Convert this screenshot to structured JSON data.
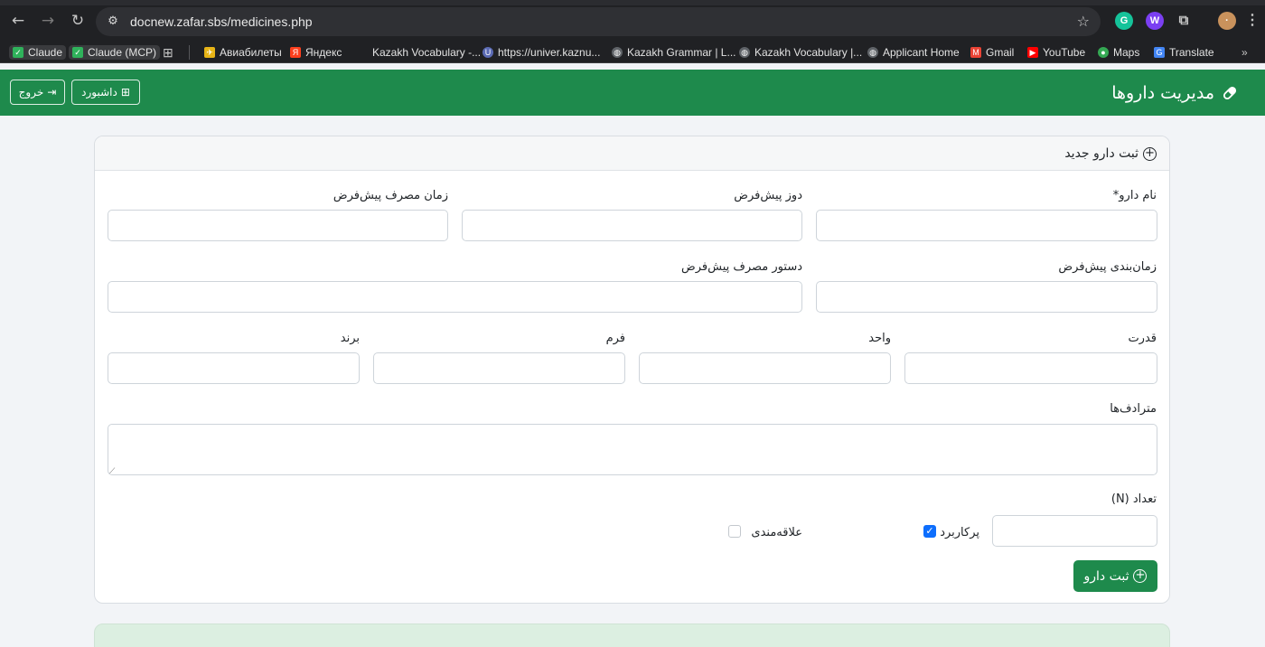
{
  "browser": {
    "url": "docnew.zafar.sbs/medicines.php",
    "bookmarks": [
      {
        "label": "Claude"
      },
      {
        "label": "Claude (MCP)"
      },
      {
        "label": "Авиабилеты"
      },
      {
        "label": "Яндекс"
      },
      {
        "label": "Kazakh Vocabulary -..."
      },
      {
        "label": "https://univer.kaznu..."
      },
      {
        "label": "Kazakh Grammar | L..."
      },
      {
        "label": "Kazakh Vocabulary |..."
      },
      {
        "label": "Applicant Home"
      },
      {
        "label": "Gmail"
      },
      {
        "label": "YouTube"
      },
      {
        "label": "Maps"
      },
      {
        "label": "Translate"
      }
    ],
    "overflow": "»"
  },
  "header": {
    "title": "مدیریت داروها",
    "dashboard_label": "داشبورد",
    "logout_label": "خروج"
  },
  "form": {
    "card_title": "ثبت دارو جدید",
    "fields": {
      "name": {
        "label": "نام دارو*",
        "value": ""
      },
      "default_dose": {
        "label": "دوز پیش‌فرض",
        "value": ""
      },
      "default_time": {
        "label": "زمان مصرف پیش‌فرض",
        "value": ""
      },
      "default_schedule": {
        "label": "زمان‌بندی پیش‌فرض",
        "value": ""
      },
      "default_instruction": {
        "label": "دستور مصرف پیش‌فرض",
        "value": ""
      },
      "strength": {
        "label": "قدرت",
        "value": ""
      },
      "unit": {
        "label": "واحد",
        "value": ""
      },
      "form": {
        "label": "فرم",
        "value": ""
      },
      "brand": {
        "label": "برند",
        "value": ""
      },
      "synonyms": {
        "label": "مترادف‌ها",
        "value": ""
      },
      "count": {
        "label": "تعداد (N)",
        "value": ""
      }
    },
    "checkboxes": {
      "frequent": {
        "label": "پرکاربرد",
        "checked": true
      },
      "favorite": {
        "label": "علاقه‌مندی",
        "checked": false
      }
    },
    "submit_label": "ثبت دارو"
  },
  "colors": {
    "brand_green": "#1e8a4c",
    "checkbox_blue": "#0d6efd"
  }
}
